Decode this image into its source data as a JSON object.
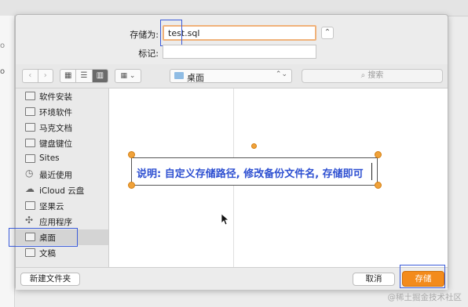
{
  "dialog": {
    "save_as_label": "存储为:",
    "filename_value": "test.sql",
    "tags_label": "标记:",
    "tags_value": "",
    "expand_icon": "chevron-up"
  },
  "toolbar": {
    "back_icon": "chevron-left",
    "forward_icon": "chevron-right",
    "view_modes": [
      "icon-view",
      "list-view",
      "column-view"
    ],
    "active_view": "column-view",
    "gallery_icon": "gallery-grid",
    "location": "桌面",
    "search_placeholder": "搜索"
  },
  "sidebar": {
    "items": [
      {
        "label": "软件安装",
        "icon": "folder-icon"
      },
      {
        "label": "环境软件",
        "icon": "folder-icon"
      },
      {
        "label": "马克文档",
        "icon": "folder-icon"
      },
      {
        "label": "键盘键位",
        "icon": "folder-icon"
      },
      {
        "label": "Sites",
        "icon": "folder-icon"
      },
      {
        "label": "最近使用",
        "icon": "clock-icon"
      },
      {
        "label": "iCloud 云盘",
        "icon": "cloud-icon"
      },
      {
        "label": "坚果云",
        "icon": "folder-icon"
      },
      {
        "label": "应用程序",
        "icon": "apps-icon"
      },
      {
        "label": "桌面",
        "icon": "desktop-icon",
        "selected": true
      },
      {
        "label": "文稿",
        "icon": "document-icon"
      }
    ]
  },
  "annotation": {
    "text": "说明: 自定义存储路径, 修改备份文件名, 存储即可"
  },
  "buttons": {
    "new_folder": "新建文件夹",
    "cancel": "取消",
    "save": "存储"
  },
  "background": {
    "glyph_a": "o",
    "glyph_b": "o"
  },
  "watermark": "@稀土掘金技术社区",
  "colors": {
    "accent_orange": "#f38b1c",
    "annotation_text": "#2d4fd1",
    "highlight_border": "#3a5bd9"
  }
}
